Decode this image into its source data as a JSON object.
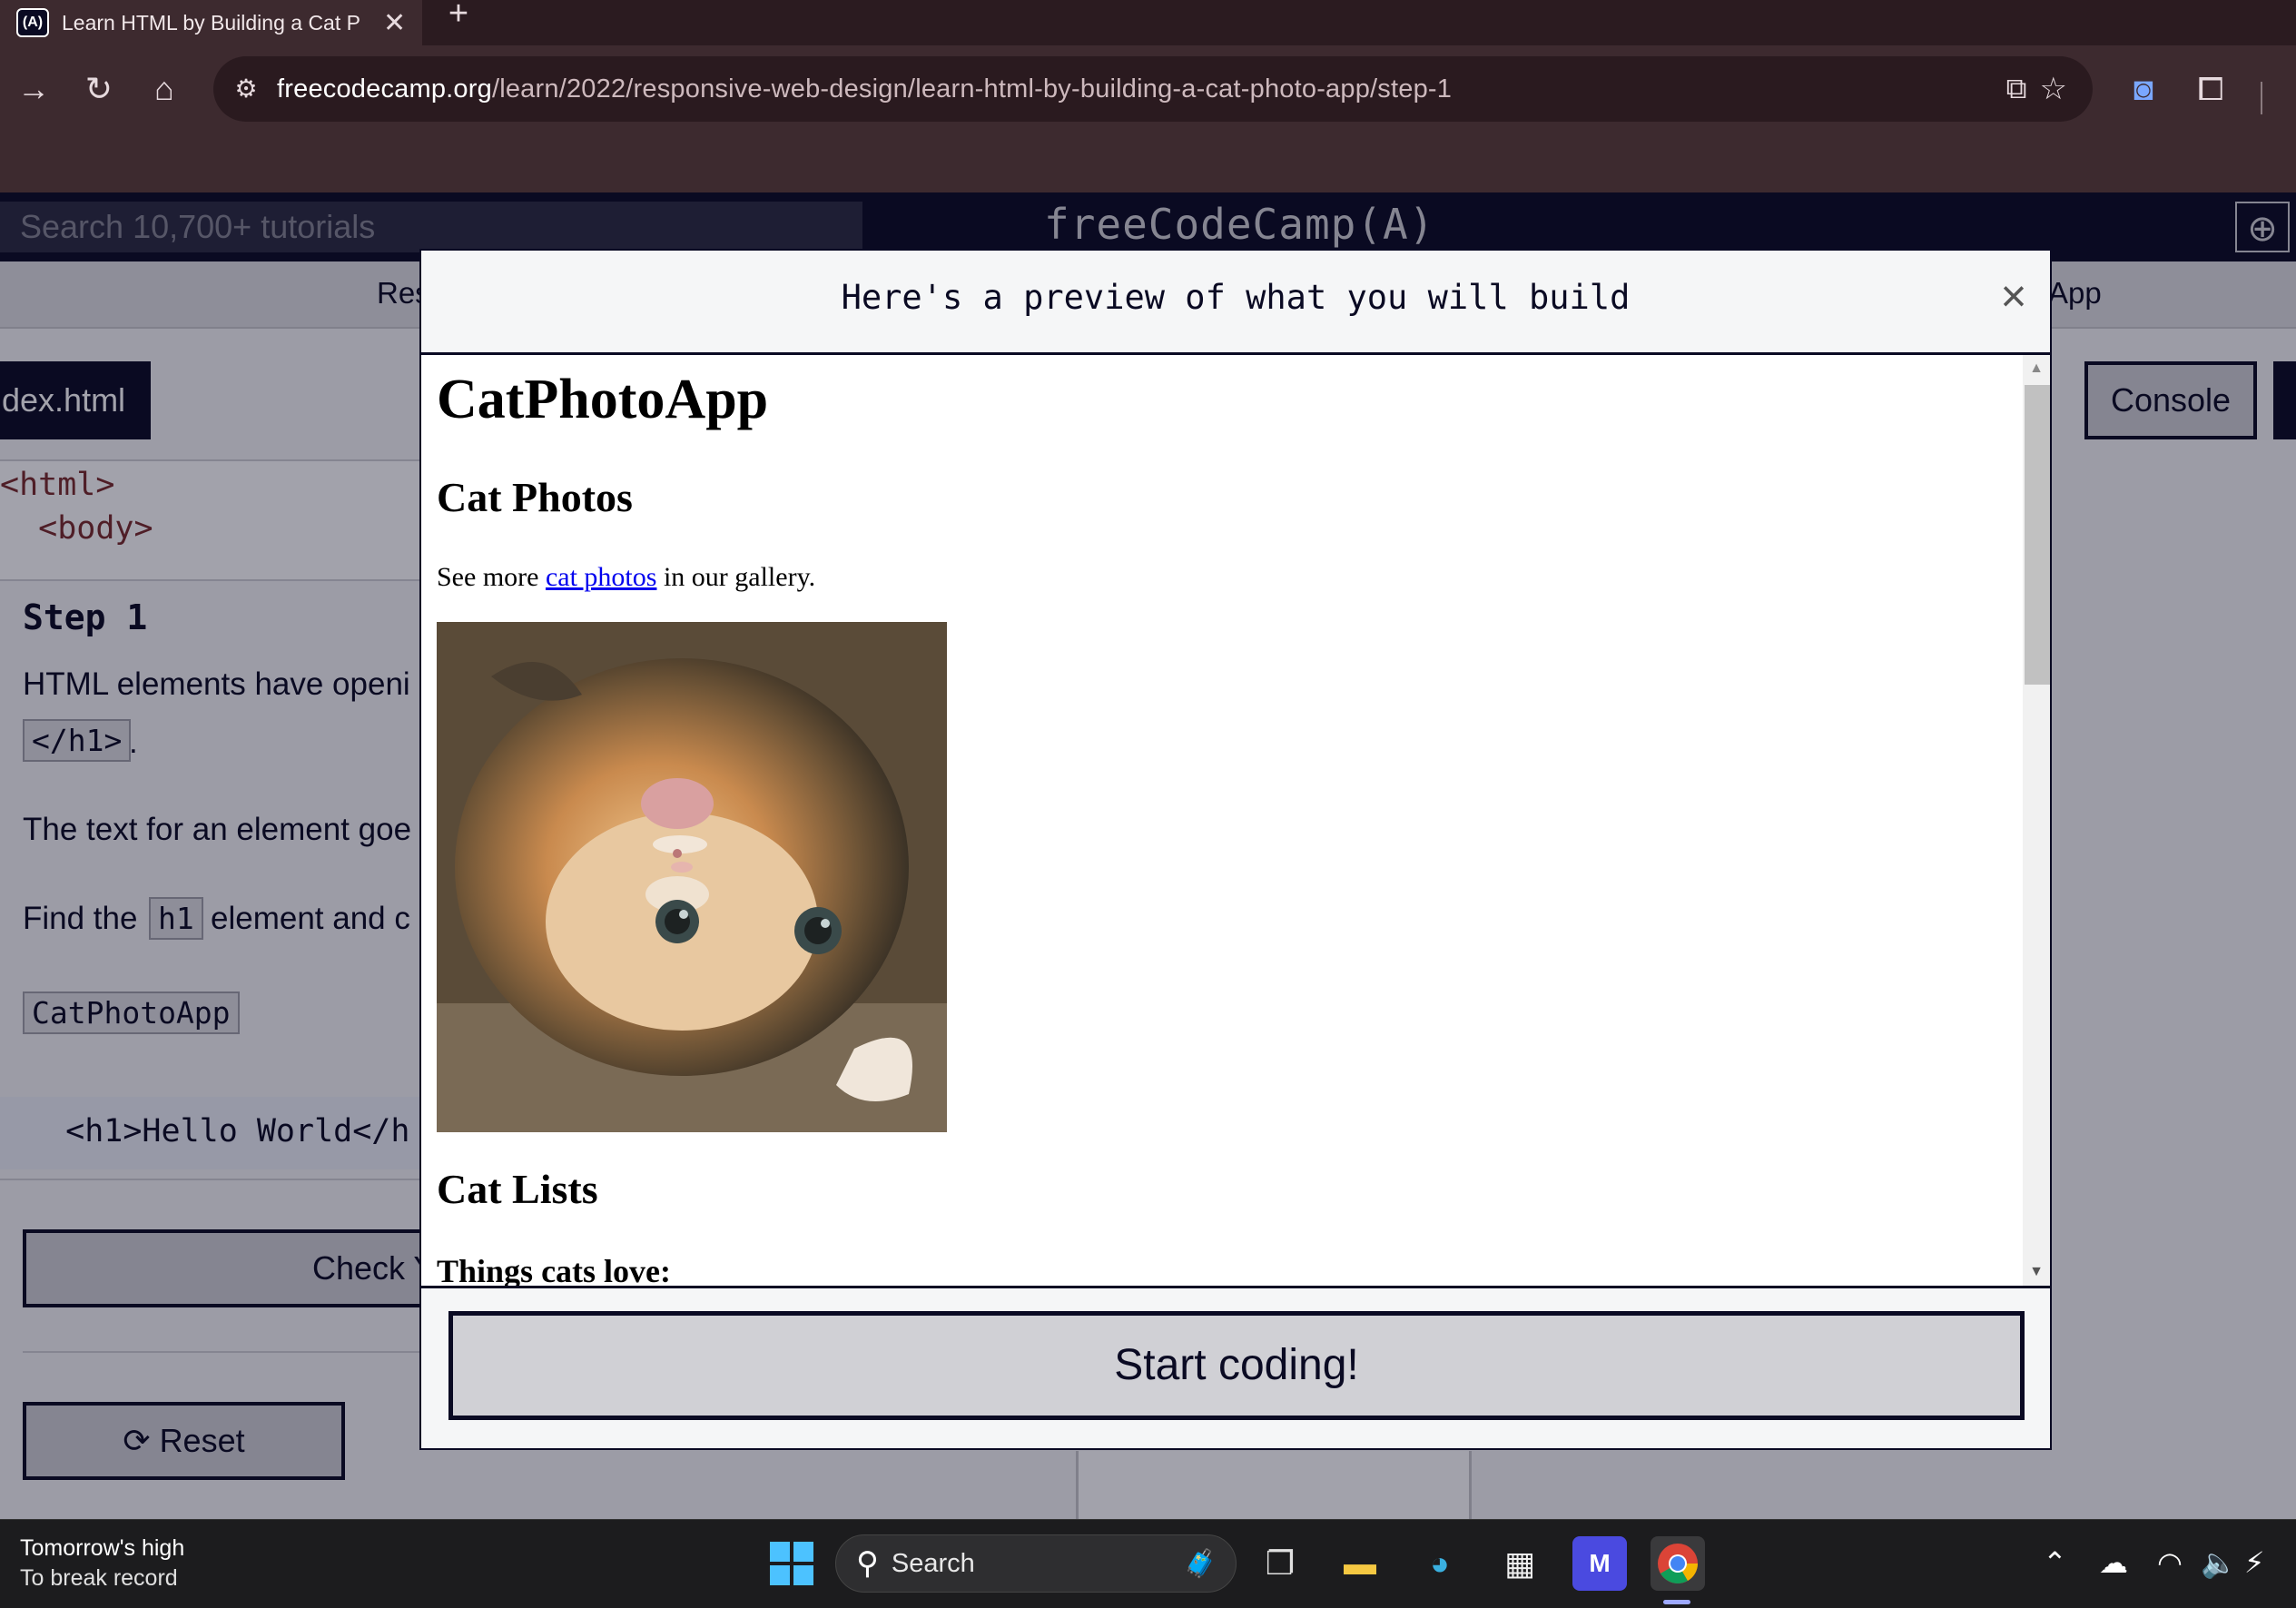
{
  "browser": {
    "tab_title": "Learn HTML by Building a Cat P",
    "favicon_text": "(A)",
    "tab_close": "✕",
    "new_tab": "+",
    "url_host": "freecodecamp.org",
    "url_path": "/learn/2022/responsive-web-design/learn-html-by-building-a-cat-photo-app/step-1"
  },
  "fcc_nav": {
    "search_placeholder": "Search 10,700+ tutorials",
    "logo": "freeCodeCamp(A)"
  },
  "page": {
    "breadcrumb_left": "Res",
    "breadcrumb_right": "App",
    "file_tab": "dex.html",
    "console_label": "Console",
    "code_lines": [
      "<html>",
      "  <body>"
    ],
    "step_title": "Step 1",
    "instr_line1": "HTML elements have openi",
    "chip_close_h1": "</h1>",
    "instr_period": ".",
    "instr_line2": "The text for an element goe",
    "instr_line3a": "Find the",
    "chip_h1": "h1",
    "instr_line3b": "element and c",
    "chip_catphotoapp": "CatPhotoApp",
    "hello_code": "  <h1>Hello World</h",
    "check_label": "Check Y",
    "reset_label": "Reset"
  },
  "modal": {
    "title": "Here's a preview of what you will build",
    "close": "×",
    "start_label": "Start coding!",
    "preview": {
      "h1": "CatPhotoApp",
      "h2_photos": "Cat Photos",
      "p_before": "See more ",
      "p_link": "cat photos",
      "p_after": " in our gallery.",
      "h2_lists": "Cat Lists",
      "h3": "Things cats love:"
    }
  },
  "taskbar": {
    "weather_line1": "Tomorrow's high",
    "weather_line2": "To break record",
    "search_label": "Search"
  },
  "colors": {
    "fcc_dark": "#0a0a23",
    "fcc_button": "#d0d0d5",
    "link": "#0000ee",
    "browser_frame": "#3d2a2f"
  }
}
